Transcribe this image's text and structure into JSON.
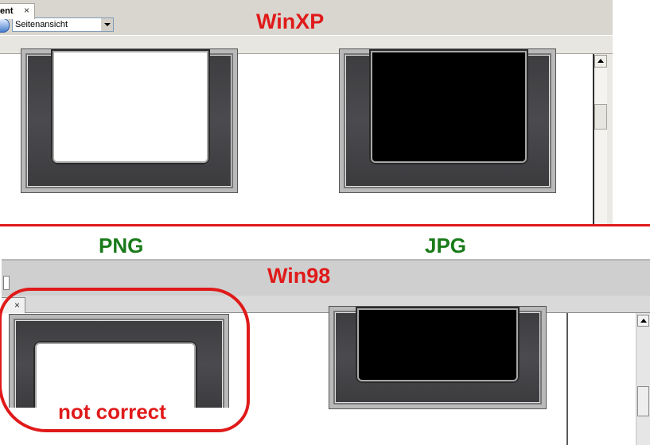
{
  "top_screenshot": {
    "title": "WinXP",
    "view_select_value": "Seitenansicht",
    "tab_label": "ent",
    "tab_close": "×"
  },
  "divider_color": "#e01a1a",
  "labels": {
    "png": "PNG",
    "jpg": "JPG"
  },
  "bottom_screenshot": {
    "title": "Win98",
    "tab_close": "×"
  },
  "annotation": {
    "text": "not correct",
    "color": "#e01a1a"
  },
  "colors": {
    "title_red": "#e01a1a",
    "label_green": "#1a7a1a"
  }
}
